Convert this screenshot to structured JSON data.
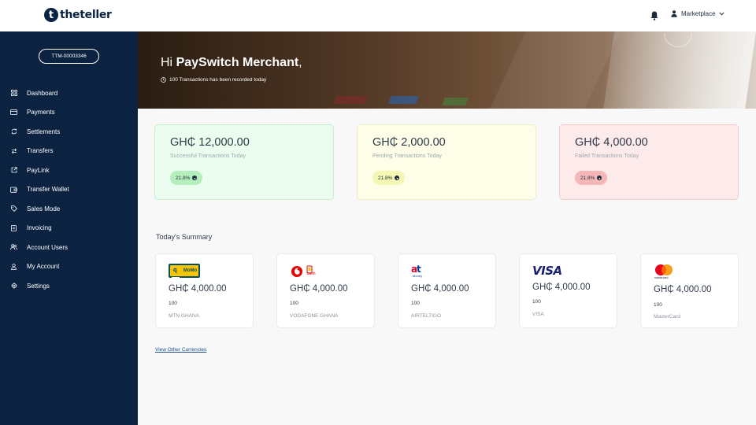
{
  "brand": {
    "logo_letter": "t",
    "name": "theteller"
  },
  "header": {
    "user_label": "Marketplace"
  },
  "sidebar": {
    "account_id": "TTM-00003346",
    "items": [
      {
        "label": "Dashboard",
        "icon": "grid-icon"
      },
      {
        "label": "Payments",
        "icon": "card-icon"
      },
      {
        "label": "Settlements",
        "icon": "refresh-icon"
      },
      {
        "label": "Transfers",
        "icon": "transfer-arrows-icon"
      },
      {
        "label": "PayLink",
        "icon": "external-link-icon"
      },
      {
        "label": "Transfer Wallet",
        "icon": "wallet-icon"
      },
      {
        "label": "Sales Mode",
        "icon": "tag-icon"
      },
      {
        "label": "Invoicing",
        "icon": "invoice-icon"
      },
      {
        "label": "Account Users",
        "icon": "users-icon"
      },
      {
        "label": "My Account",
        "icon": "user-icon"
      },
      {
        "label": "Settings",
        "icon": "gear-icon"
      }
    ]
  },
  "hero": {
    "greeting_prefix": "Hi ",
    "merchant_name": "PaySwitch Merchant",
    "greeting_suffix": ",",
    "subtitle": "100 Transactions has been recorded today"
  },
  "stats": [
    {
      "amount": "GH₵ 12,000.00",
      "label": "Successful Transactions Today",
      "badge": "21.8%",
      "color": "#b3eebc"
    },
    {
      "amount": "GH₵ 2,000.00",
      "label": "Pending Transactions Today",
      "badge": "21.8%",
      "color": "#f4f6b4"
    },
    {
      "amount": "GH₵ 4,000.00",
      "label": "Failed Transactions Today",
      "badge": "21.8%",
      "color": "#f4b6b6"
    }
  ],
  "summary": {
    "title": "Today's Summary",
    "cards": [
      {
        "amount": "GH₵ 4,000.00",
        "count": "100",
        "name": "MTN GHANA",
        "logo_text": "MoMo"
      },
      {
        "amount": "GH₵ 4,000.00",
        "count": "100",
        "name": "VODAFONE GHANA",
        "logo_text": "cash"
      },
      {
        "amount": "GH₵ 4,000.00",
        "count": "100",
        "name": "AIRTELTIGO",
        "logo_text": "Money"
      },
      {
        "amount": "GH₵ 4,000.00",
        "count": "100",
        "name": "VISA",
        "logo_text": "VISA"
      },
      {
        "amount": "GH₵ 4,000.00",
        "count": "100",
        "name": "MasterCard",
        "logo_text": "mastercard"
      }
    ],
    "link": "View Other Currencies"
  }
}
